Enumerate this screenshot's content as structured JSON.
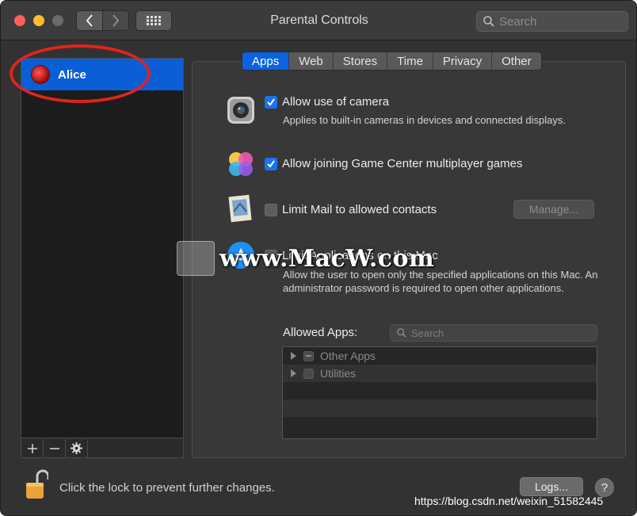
{
  "window": {
    "title": "Parental Controls"
  },
  "toolbar": {
    "search_placeholder": "Search"
  },
  "sidebar": {
    "users": [
      {
        "name": "Alice"
      }
    ]
  },
  "tabs": [
    "Apps",
    "Web",
    "Stores",
    "Time",
    "Privacy",
    "Other"
  ],
  "options": {
    "camera": {
      "label": "Allow use of camera",
      "description": "Applies to built-in cameras in devices and connected displays.",
      "checked": true
    },
    "gamecenter": {
      "label": "Allow joining Game Center multiplayer games",
      "checked": true
    },
    "mail": {
      "label": "Limit Mail to allowed contacts",
      "checked": false,
      "manage_label": "Manage..."
    },
    "apps": {
      "label": "Limit Applications on this Mac",
      "description": "Allow the user to open only the specified applications on this Mac. An administrator password is required to open other applications.",
      "checked": false
    }
  },
  "allowed_apps": {
    "label": "Allowed Apps:",
    "search_placeholder": "Search",
    "items": [
      "Other Apps",
      "Utilities"
    ]
  },
  "footer": {
    "lock_text": "Click the lock to prevent further changes.",
    "logs_label": "Logs...",
    "help_label": "?"
  },
  "watermark": {
    "text": "www.MacW.com"
  },
  "source_caption": "https://blog.csdn.net/weixin_51582445",
  "colors": {
    "accent": "#0a63e0",
    "highlight_ring": "#e0241b"
  },
  "icons": [
    "search-icon",
    "back-chevron-icon",
    "forward-chevron-icon",
    "grid-icon",
    "camera-icon",
    "game-center-icon",
    "mail-icon",
    "app-store-icon",
    "lock-icon",
    "gear-icon",
    "plus-icon",
    "minus-icon"
  ]
}
